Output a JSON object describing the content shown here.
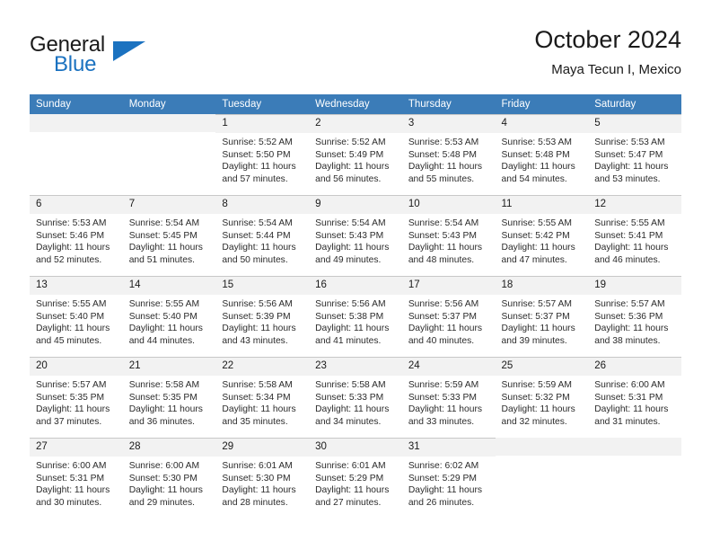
{
  "brand": {
    "name_part1": "General",
    "name_part2": "Blue",
    "logo_icon": "triangle-flag-icon"
  },
  "header": {
    "title": "October 2024",
    "subtitle": "Maya Tecun I, Mexico"
  },
  "colors": {
    "header_row": "#3b7cb8",
    "brand_blue": "#1b72c0",
    "daynum_background": "#f2f2f2",
    "cell_border": "#c8c8c8"
  },
  "calendar": {
    "weekday_headers": [
      "Sunday",
      "Monday",
      "Tuesday",
      "Wednesday",
      "Thursday",
      "Friday",
      "Saturday"
    ],
    "weeks": [
      [
        {
          "day": "",
          "sunrise": "",
          "sunset": "",
          "daylight": ""
        },
        {
          "day": "",
          "sunrise": "",
          "sunset": "",
          "daylight": ""
        },
        {
          "day": "1",
          "sunrise": "Sunrise: 5:52 AM",
          "sunset": "Sunset: 5:50 PM",
          "daylight": "Daylight: 11 hours and 57 minutes."
        },
        {
          "day": "2",
          "sunrise": "Sunrise: 5:52 AM",
          "sunset": "Sunset: 5:49 PM",
          "daylight": "Daylight: 11 hours and 56 minutes."
        },
        {
          "day": "3",
          "sunrise": "Sunrise: 5:53 AM",
          "sunset": "Sunset: 5:48 PM",
          "daylight": "Daylight: 11 hours and 55 minutes."
        },
        {
          "day": "4",
          "sunrise": "Sunrise: 5:53 AM",
          "sunset": "Sunset: 5:48 PM",
          "daylight": "Daylight: 11 hours and 54 minutes."
        },
        {
          "day": "5",
          "sunrise": "Sunrise: 5:53 AM",
          "sunset": "Sunset: 5:47 PM",
          "daylight": "Daylight: 11 hours and 53 minutes."
        }
      ],
      [
        {
          "day": "6",
          "sunrise": "Sunrise: 5:53 AM",
          "sunset": "Sunset: 5:46 PM",
          "daylight": "Daylight: 11 hours and 52 minutes."
        },
        {
          "day": "7",
          "sunrise": "Sunrise: 5:54 AM",
          "sunset": "Sunset: 5:45 PM",
          "daylight": "Daylight: 11 hours and 51 minutes."
        },
        {
          "day": "8",
          "sunrise": "Sunrise: 5:54 AM",
          "sunset": "Sunset: 5:44 PM",
          "daylight": "Daylight: 11 hours and 50 minutes."
        },
        {
          "day": "9",
          "sunrise": "Sunrise: 5:54 AM",
          "sunset": "Sunset: 5:43 PM",
          "daylight": "Daylight: 11 hours and 49 minutes."
        },
        {
          "day": "10",
          "sunrise": "Sunrise: 5:54 AM",
          "sunset": "Sunset: 5:43 PM",
          "daylight": "Daylight: 11 hours and 48 minutes."
        },
        {
          "day": "11",
          "sunrise": "Sunrise: 5:55 AM",
          "sunset": "Sunset: 5:42 PM",
          "daylight": "Daylight: 11 hours and 47 minutes."
        },
        {
          "day": "12",
          "sunrise": "Sunrise: 5:55 AM",
          "sunset": "Sunset: 5:41 PM",
          "daylight": "Daylight: 11 hours and 46 minutes."
        }
      ],
      [
        {
          "day": "13",
          "sunrise": "Sunrise: 5:55 AM",
          "sunset": "Sunset: 5:40 PM",
          "daylight": "Daylight: 11 hours and 45 minutes."
        },
        {
          "day": "14",
          "sunrise": "Sunrise: 5:55 AM",
          "sunset": "Sunset: 5:40 PM",
          "daylight": "Daylight: 11 hours and 44 minutes."
        },
        {
          "day": "15",
          "sunrise": "Sunrise: 5:56 AM",
          "sunset": "Sunset: 5:39 PM",
          "daylight": "Daylight: 11 hours and 43 minutes."
        },
        {
          "day": "16",
          "sunrise": "Sunrise: 5:56 AM",
          "sunset": "Sunset: 5:38 PM",
          "daylight": "Daylight: 11 hours and 41 minutes."
        },
        {
          "day": "17",
          "sunrise": "Sunrise: 5:56 AM",
          "sunset": "Sunset: 5:37 PM",
          "daylight": "Daylight: 11 hours and 40 minutes."
        },
        {
          "day": "18",
          "sunrise": "Sunrise: 5:57 AM",
          "sunset": "Sunset: 5:37 PM",
          "daylight": "Daylight: 11 hours and 39 minutes."
        },
        {
          "day": "19",
          "sunrise": "Sunrise: 5:57 AM",
          "sunset": "Sunset: 5:36 PM",
          "daylight": "Daylight: 11 hours and 38 minutes."
        }
      ],
      [
        {
          "day": "20",
          "sunrise": "Sunrise: 5:57 AM",
          "sunset": "Sunset: 5:35 PM",
          "daylight": "Daylight: 11 hours and 37 minutes."
        },
        {
          "day": "21",
          "sunrise": "Sunrise: 5:58 AM",
          "sunset": "Sunset: 5:35 PM",
          "daylight": "Daylight: 11 hours and 36 minutes."
        },
        {
          "day": "22",
          "sunrise": "Sunrise: 5:58 AM",
          "sunset": "Sunset: 5:34 PM",
          "daylight": "Daylight: 11 hours and 35 minutes."
        },
        {
          "day": "23",
          "sunrise": "Sunrise: 5:58 AM",
          "sunset": "Sunset: 5:33 PM",
          "daylight": "Daylight: 11 hours and 34 minutes."
        },
        {
          "day": "24",
          "sunrise": "Sunrise: 5:59 AM",
          "sunset": "Sunset: 5:33 PM",
          "daylight": "Daylight: 11 hours and 33 minutes."
        },
        {
          "day": "25",
          "sunrise": "Sunrise: 5:59 AM",
          "sunset": "Sunset: 5:32 PM",
          "daylight": "Daylight: 11 hours and 32 minutes."
        },
        {
          "day": "26",
          "sunrise": "Sunrise: 6:00 AM",
          "sunset": "Sunset: 5:31 PM",
          "daylight": "Daylight: 11 hours and 31 minutes."
        }
      ],
      [
        {
          "day": "27",
          "sunrise": "Sunrise: 6:00 AM",
          "sunset": "Sunset: 5:31 PM",
          "daylight": "Daylight: 11 hours and 30 minutes."
        },
        {
          "day": "28",
          "sunrise": "Sunrise: 6:00 AM",
          "sunset": "Sunset: 5:30 PM",
          "daylight": "Daylight: 11 hours and 29 minutes."
        },
        {
          "day": "29",
          "sunrise": "Sunrise: 6:01 AM",
          "sunset": "Sunset: 5:30 PM",
          "daylight": "Daylight: 11 hours and 28 minutes."
        },
        {
          "day": "30",
          "sunrise": "Sunrise: 6:01 AM",
          "sunset": "Sunset: 5:29 PM",
          "daylight": "Daylight: 11 hours and 27 minutes."
        },
        {
          "day": "31",
          "sunrise": "Sunrise: 6:02 AM",
          "sunset": "Sunset: 5:29 PM",
          "daylight": "Daylight: 11 hours and 26 minutes."
        },
        {
          "day": "",
          "sunrise": "",
          "sunset": "",
          "daylight": ""
        },
        {
          "day": "",
          "sunrise": "",
          "sunset": "",
          "daylight": ""
        }
      ]
    ]
  }
}
